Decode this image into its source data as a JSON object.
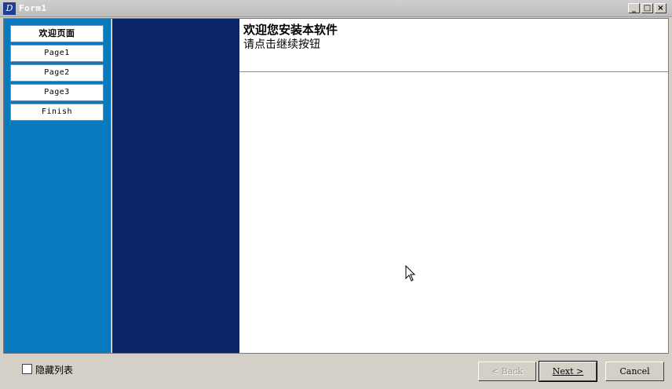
{
  "window": {
    "title": "Form1",
    "icon": "delphi-app-icon",
    "minimize": "_",
    "maximize": "□",
    "close": "×"
  },
  "sidebar": {
    "items": [
      {
        "label": "欢迎页面",
        "active": true
      },
      {
        "label": "Page1",
        "active": false
      },
      {
        "label": "Page2",
        "active": false
      },
      {
        "label": "Page3",
        "active": false
      },
      {
        "label": "Finish",
        "active": false
      }
    ]
  },
  "content": {
    "heading": "欢迎您安装本软件",
    "subheading": "请点击继续按钮"
  },
  "footer": {
    "hide_list_label": "隐藏列表",
    "hide_list_checked": false,
    "back_label": "< Back",
    "next_label": "Next >",
    "cancel_label": "Cancel"
  },
  "colors": {
    "sidebar": "#0a7abf",
    "banner": "#0a246a",
    "chrome": "#d4d0c8"
  }
}
